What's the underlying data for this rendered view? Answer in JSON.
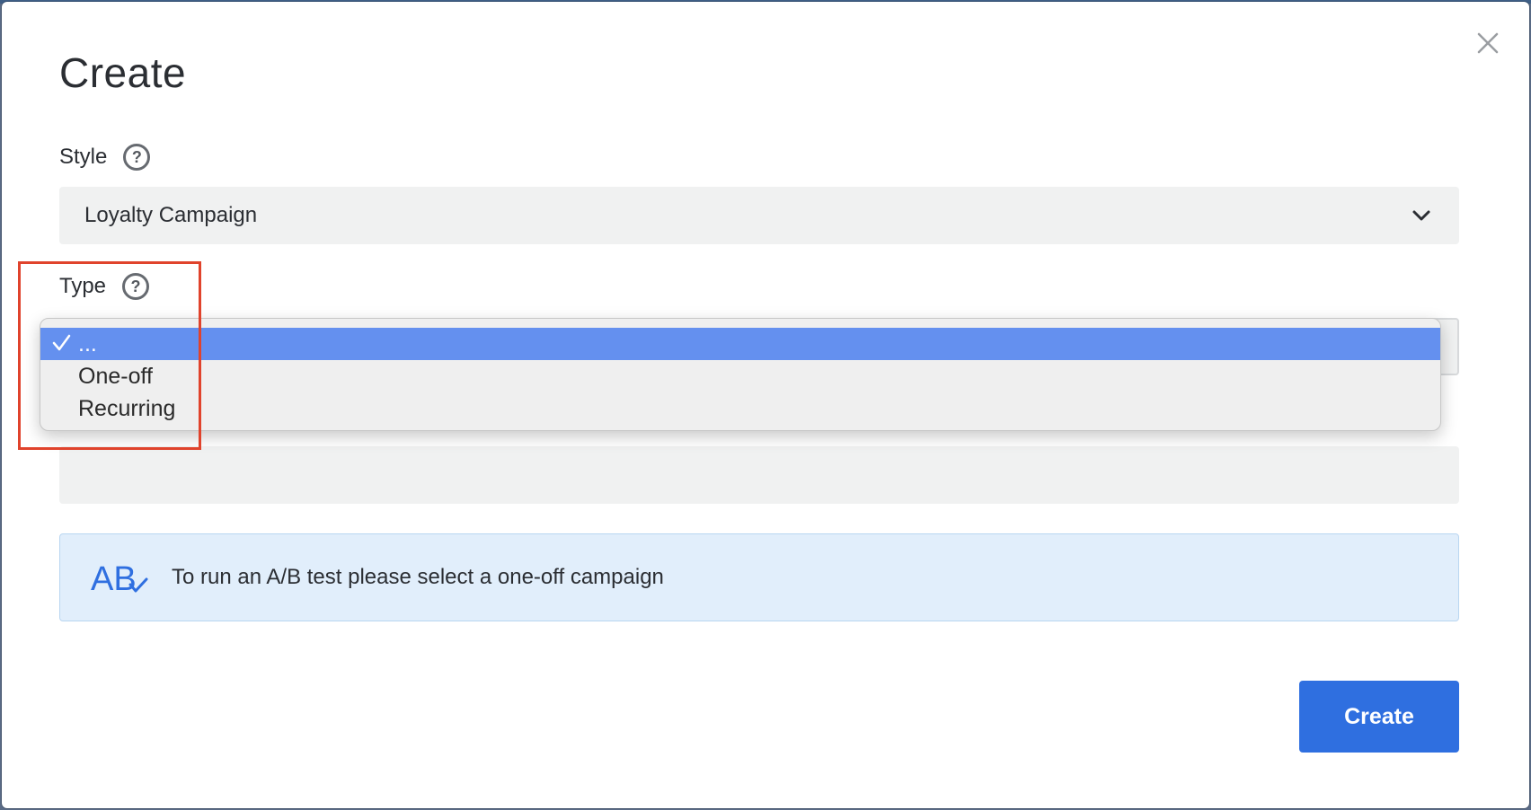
{
  "modal": {
    "title": "Create",
    "close_icon": "close-icon"
  },
  "style_field": {
    "label": "Style",
    "help_icon": "question-circle-icon",
    "value": "Loyalty Campaign",
    "chevron_icon": "chevron-down-icon"
  },
  "type_field": {
    "label": "Type",
    "help_icon": "question-circle-icon",
    "dropdown_open": true,
    "options": [
      {
        "label": "...",
        "selected": true
      },
      {
        "label": "One-off",
        "selected": false
      },
      {
        "label": "Recurring",
        "selected": false
      }
    ]
  },
  "info_banner": {
    "icon": "ab-test-icon",
    "text": "To run an A/B test please select a one-off campaign"
  },
  "actions": {
    "create_label": "Create"
  },
  "colors": {
    "primary": "#2f6fe0",
    "selected_option": "#6490ef",
    "banner_bg": "#e1eefb",
    "highlight": "#e0432c"
  }
}
